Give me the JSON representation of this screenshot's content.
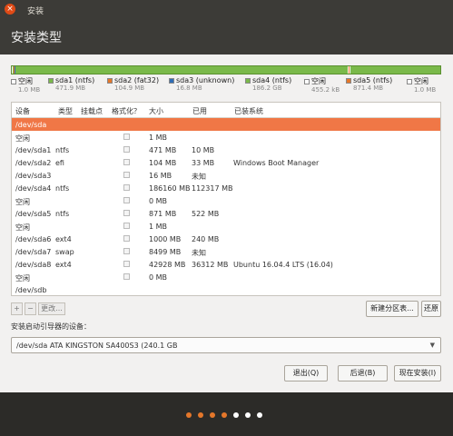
{
  "window": {
    "title": "安装",
    "close_glyph": "×"
  },
  "header": {
    "title": "安装类型"
  },
  "partition_bar": [
    {
      "name": "空闲",
      "size": "1.0 MB",
      "color": "#ffffff",
      "frac": 0.001
    },
    {
      "name": "sda1 (ntfs)",
      "size": "471.9 MB",
      "color": "#7ab94a",
      "frac": 0.0019
    },
    {
      "name": "sda2 (fat32)",
      "size": "104.9 MB",
      "color": "#e5772a",
      "frac": 0.0004
    },
    {
      "name": "sda3 (unknown)",
      "size": "16.8 MB",
      "color": "#2f6db5",
      "frac": 0.0001
    },
    {
      "name": "sda4 (ntfs)",
      "size": "186.2 GB",
      "color": "#7ab94a",
      "frac": 0.7744
    },
    {
      "name": "空闲",
      "size": "455.2 kB",
      "color": "#ffffff",
      "frac": 0.0001
    },
    {
      "name": "sda5 (ntfs)",
      "size": "871.4 MB",
      "color": "#e5772a",
      "frac": 0.0036
    },
    {
      "name": "空闲",
      "size": "1.0 MB",
      "color": "#ffffff",
      "frac": 0.001
    }
  ],
  "table": {
    "headers": [
      "设备",
      "类型",
      "挂载点",
      "格式化？",
      "大小",
      "已用",
      "已装系统"
    ],
    "rows": [
      {
        "device": "/dev/sda",
        "type": "",
        "size": "",
        "used": "",
        "system": "",
        "selected": true,
        "check": false
      },
      {
        "device": "空闲",
        "type": "",
        "size": "1 MB",
        "used": "",
        "system": "",
        "check": true
      },
      {
        "device": "/dev/sda1",
        "type": "ntfs",
        "size": "471 MB",
        "used": "10 MB",
        "system": "",
        "check": true
      },
      {
        "device": "/dev/sda2",
        "type": "efi",
        "size": "104 MB",
        "used": "33 MB",
        "system": "Windows Boot Manager",
        "check": true
      },
      {
        "device": "/dev/sda3",
        "type": "",
        "size": "16 MB",
        "used": "未知",
        "system": "",
        "check": true
      },
      {
        "device": "/dev/sda4",
        "type": "ntfs",
        "size": "186160 MB",
        "used": "112317 MB",
        "system": "",
        "check": true
      },
      {
        "device": "空闲",
        "type": "",
        "size": "0 MB",
        "used": "",
        "system": "",
        "check": true
      },
      {
        "device": "/dev/sda5",
        "type": "ntfs",
        "size": "871 MB",
        "used": "522 MB",
        "system": "",
        "check": true
      },
      {
        "device": "空闲",
        "type": "",
        "size": "1 MB",
        "used": "",
        "system": "",
        "check": true
      },
      {
        "device": "/dev/sda6",
        "type": "ext4",
        "size": "1000 MB",
        "used": "240 MB",
        "system": "",
        "check": true
      },
      {
        "device": "/dev/sda7",
        "type": "swap",
        "size": "8499 MB",
        "used": "未知",
        "system": "",
        "check": true
      },
      {
        "device": "/dev/sda8",
        "type": "ext4",
        "size": "42928 MB",
        "used": "36312 MB",
        "system": "Ubuntu 16.04.4 LTS (16.04)",
        "check": true
      },
      {
        "device": "空闲",
        "type": "",
        "size": "0 MB",
        "used": "",
        "system": "",
        "check": true
      },
      {
        "device": "/dev/sdb",
        "type": "",
        "size": "",
        "used": "",
        "system": "",
        "check": false
      }
    ]
  },
  "toolbar": {
    "add": "+",
    "remove": "−",
    "change": "更改...",
    "new_table": "新建分区表...",
    "revert": "还原"
  },
  "bootloader": {
    "label": "安装启动引导器的设备：",
    "value": "/dev/sda   ATA KINGSTON SA400S3 (240.1 GB",
    "arrow": "▼"
  },
  "buttons": {
    "quit": "退出(Q)",
    "back": "后退(B)",
    "install": "现在安装(I)"
  },
  "progress_dots": [
    "#e5772a",
    "#e5772a",
    "#e5772a",
    "#e5772a",
    "#ffffff",
    "#ffffff",
    "#ffffff"
  ]
}
